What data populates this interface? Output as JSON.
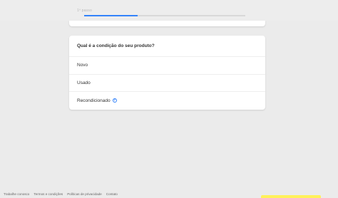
{
  "header": {
    "step_label": "1º passo",
    "progress_fraction": 0.33
  },
  "question": {
    "title": "Qual é a condição do seu produto?",
    "options": [
      {
        "label": "Novo"
      },
      {
        "label": "Usado"
      },
      {
        "label": "Recondicionado",
        "help_icon": "question-circle-icon"
      }
    ]
  },
  "footer": {
    "links": [
      "Trabalhe conosco",
      "Termos e condições",
      "Políticas de privacidade",
      "Contato"
    ]
  },
  "colors": {
    "accent": "#3483fa",
    "brand_yellow": "#fff159",
    "background": "#ebebeb"
  }
}
